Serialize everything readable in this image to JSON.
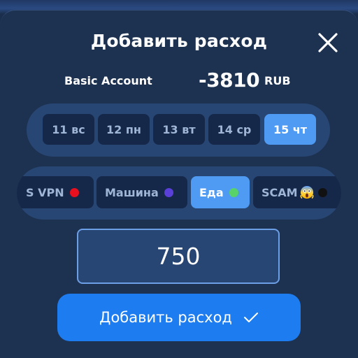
{
  "sheet": {
    "title": "Добавить расход",
    "close_icon": "close-icon"
  },
  "account": {
    "name": "Basic Account",
    "balance": "-3810",
    "currency": "RUB"
  },
  "dates": [
    {
      "label": "11 вс",
      "selected": false
    },
    {
      "label": "12 пн",
      "selected": false
    },
    {
      "label": "13 вт",
      "selected": false
    },
    {
      "label": "14 ср",
      "selected": false
    },
    {
      "label": "15 чт",
      "selected": true
    }
  ],
  "categories": [
    {
      "label": "S VPN",
      "dot_color": "#e8101e",
      "selected": false
    },
    {
      "label": "Машина",
      "dot_color": "#5b3fd9",
      "selected": false
    },
    {
      "label": "Еда",
      "dot_color": "#57d36a",
      "selected": true
    },
    {
      "label": "SCAM",
      "icon": "screaming-face-icon",
      "selected": false
    }
  ],
  "amount": {
    "value": "750"
  },
  "submit": {
    "label": "Добавить расход",
    "icon": "checkmark-icon"
  },
  "colors": {
    "background": "#1d3150",
    "bar": "#284673",
    "chip": "#15284a",
    "chip_text": "#9fb6d6",
    "accent": "#4f9bf4",
    "button": "#1d7df0"
  }
}
